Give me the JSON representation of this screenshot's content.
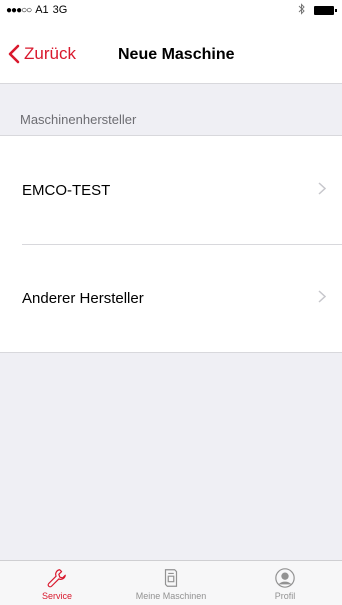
{
  "status_bar": {
    "signal": "●●●○○",
    "carrier": "A1",
    "network": "3G"
  },
  "nav": {
    "back_label": "Zurück",
    "title": "Neue Maschine"
  },
  "section": {
    "header": "Maschinenhersteller"
  },
  "list": {
    "items": [
      {
        "label": "EMCO-TEST"
      },
      {
        "label": "Anderer Hersteller"
      }
    ]
  },
  "tab_bar": {
    "tabs": [
      {
        "label": "Service",
        "icon": "wrench-icon",
        "active": true
      },
      {
        "label": "Meine Maschinen",
        "icon": "machine-icon",
        "active": false
      },
      {
        "label": "Profil",
        "icon": "profile-icon",
        "active": false
      }
    ]
  },
  "colors": {
    "accent": "#d9182d",
    "background": "#efeff4",
    "inactive": "#929292"
  }
}
